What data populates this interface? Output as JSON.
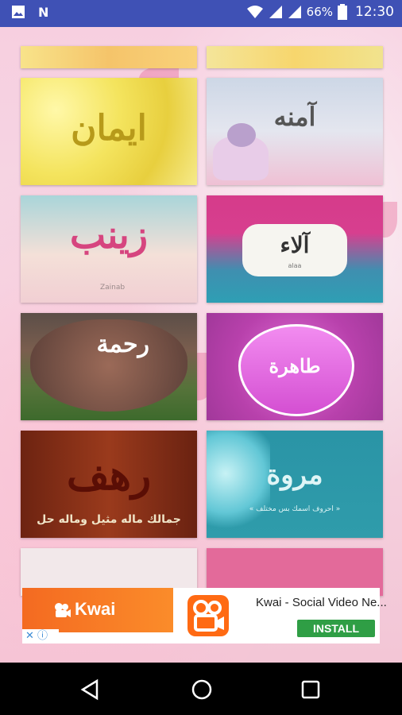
{
  "status_bar": {
    "icons": [
      "image-icon",
      "n-app-icon",
      "wifi-icon",
      "signal-icon",
      "signal-icon",
      "battery-icon"
    ],
    "battery": "66%",
    "time": "12:30",
    "color": "#3f51b5"
  },
  "tiles": [
    {
      "name": ""
    },
    {
      "name": ""
    },
    {
      "name": "ايمان"
    },
    {
      "name": "آمنه"
    },
    {
      "name": "زينب",
      "sub": "Zainab"
    },
    {
      "name": "آلاء",
      "sub": "alaa"
    },
    {
      "name": "رحمة"
    },
    {
      "name": "طاهرة"
    },
    {
      "name": "رهف",
      "sub": "جمالك ماله مثيل وماله حل"
    },
    {
      "name": "مروة",
      "sub": "« احروف اسمك بس مختلف »"
    },
    {
      "name": ""
    },
    {
      "name": ""
    }
  ],
  "ad": {
    "brand": "Kwai",
    "title": "Kwai - Social Video Ne...",
    "install_label": "INSTALL",
    "adchoices": "✕ ⓘ"
  },
  "navbar": {
    "back": "back-icon",
    "home": "home-icon",
    "recents": "recents-icon"
  }
}
